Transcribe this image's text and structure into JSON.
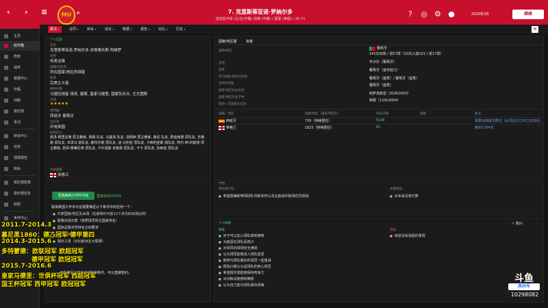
{
  "top": {
    "club_crest_text": "MU",
    "player_title": "7. 克里斯蒂亚诺·罗纳尔多",
    "player_sub": "进攻型中场 (右/左/中路) 前锋 (中路) / 曼联 (英超) / 26 (?)",
    "date": "2026年3月",
    "continue_label": "继续"
  },
  "sidebar": {
    "items": [
      {
        "label": "主页"
      },
      {
        "label": "收件箱"
      },
      {
        "label": "阵容"
      },
      {
        "label": "战术"
      },
      {
        "label": "数据中心"
      },
      {
        "label": "日程"
      },
      {
        "label": "训练"
      },
      {
        "label": "俱乐部"
      },
      {
        "label": "青训"
      },
      {
        "label": "转会中心"
      },
      {
        "label": "任务"
      },
      {
        "label": "球探报告"
      },
      {
        "label": "转会"
      },
      {
        "label": "俱乐部愿景"
      },
      {
        "label": "俱乐部信息"
      },
      {
        "label": "财政"
      },
      {
        "label": "世界中心"
      }
    ]
  },
  "tabs": [
    {
      "label": "概况"
    },
    {
      "label": "合同"
    },
    {
      "label": "转会"
    },
    {
      "label": "成长"
    },
    {
      "label": "数据"
    },
    {
      "label": "报告"
    },
    {
      "label": "对比"
    },
    {
      "label": "历史"
    }
  ],
  "left": {
    "header": "个人信息",
    "full_name_label": "全名",
    "full_name": "克里斯蒂亚诺·罗纳尔多·多斯桑托斯·阿维罗",
    "nickname_label": "昵称",
    "nickname": "传奇边锋",
    "origin_label": "国籍/出生地",
    "origin": "所在国家/地区的球星",
    "personality_label": "性格",
    "personality": "完美主义者",
    "media_label": "媒体形象",
    "media": "马德拉球星 球员, 曼联, 皇家马德里, 国家队队长, 尤文图斯",
    "rep_label": "声望",
    "stars": "★★★★★",
    "foot_label": "惯用脚",
    "foot": "西班牙·葡萄牙",
    "hometown_label": "出生地",
    "hometown": "闪电英国",
    "relations_label": "欣赏的人",
    "relations": "若泽·穆里尼奥 原主教练, 佩佩 队友, 马塞洛 队友, 范佩西 原主教练, 鲁尼 队友, 费迪南德 原队友, 吉格斯 原队友, 本泽马 前队友, 斯科尔斯 原队友, 迪·马利亚 原队友, 卡西利亚斯 前队友, 阿尔·西·科斯塔 原主教练, 若昂·穆蒂尼奥 原队友, 卡尔洛斯·克鲁斯 原队友, 卡卡 原队友, 加西亚 原队友",
    "flag_label": "代表国家",
    "flag_country": "英格兰"
  },
  "contract": {
    "loan_button": "至纳纳纳工作许可证",
    "expiry": "直到30/6/2029",
    "intro": "取得英国工作许可证需要满足以下条件中的任何一个：",
    "conditions": [
      "代表国家/地区队出场（在获得许可前12个月内的出场比例）",
      "联赛出场次数（按照球员所在国家排名）",
      "国际足联世界排名达到要求",
      "俱乐部转会费",
      "相对工资（对比欧洲五大联赛）"
    ],
    "note": "目前满足工作许可证取得条件，可以直接签约。"
  },
  "nations": {
    "tab_a": "国籍/地区服",
    "tab_b": "资格",
    "subhead": "国籍/地区",
    "national_team_label": "出生地",
    "national_team_val": "葡萄牙",
    "caps_label": "出场",
    "caps_val": "141次出场 / 进57球（10次入选U21 / 进17球）",
    "first_label": "首秀",
    "first_val": "丰沙尔（葡萄牙）",
    "birthplace_label": "效力国家/地区的资格",
    "birthplace_val": "葡萄牙（宣布效力）",
    "wc_label": "世界杯次数",
    "wc_val": "葡萄牙（首秀）/ 葡萄牙（首秀）",
    "euro_label": "国家/地区队总出场",
    "euro_val": "葡萄牙（首秀）",
    "debut_label": "国家/地区队处子秀",
    "debut_val": "哈萨克斯坦（20/8/2003）",
    "last_label": "最后一次国家队出场",
    "last_val": "希腊（12/6/2004）",
    "table_headers": [
      "国籍 / 地区",
      "国籍/地区（国家/地区队）",
      "归化日期",
      "国籍",
      "备注"
    ],
    "rows": [
      {
        "country": "西班牙",
        "status": "730（持续居住）",
        "days": "5144",
        "note": "需要在西班牙居住（必须在122天之内归化）"
      },
      {
        "country": "英格兰",
        "status": "1825（持续居住）",
        "days": "61",
        "note": "剩余1764天"
      }
    ]
  },
  "plans": {
    "header": "计划",
    "col_a": "俱乐部计划",
    "col_b": "长期规划",
    "item_a": "希望莫蒂斯带领球队夺取奖杯以及在欧战中取得优异成绩",
    "item_b": "对未来没有打算"
  },
  "personal": {
    "header": "个人情绪",
    "happy_label": "高兴",
    "positives_header": "积极",
    "positives": [
      "对于可以加入球队感到满意",
      "为能留在球队而高兴",
      "对球员的球场安全满意",
      "认为球员能够进入球队首发",
      "期待与球队最好的球员一起奋战",
      "很高兴被认为是球队的核心球员",
      "希望俱乐部能够保持竞争力",
      "对训练设施感到满意",
      "认为自己能为球队做出贡献"
    ],
    "negatives_header": "消极",
    "negatives": [
      "目前没有消极的事情"
    ]
  },
  "overlay": {
    "lines": [
      "2011.7-2014.3",
      "慕尼黑1860：德乙冠军 德甲第四",
      "2014.3-2015.6",
      "多特蒙德：欧联冠军 欧超冠军",
      "德甲冠军 欧冠冠军",
      "2015.7-2016.6",
      "皇家马德里：世俱杯冠军 西超冠军",
      "国王杯冠军  西甲冠军  欧冠冠军"
    ],
    "douyu_logo": "斗鱼",
    "douyu_room_label": "房间号",
    "douyu_id": "10298082"
  },
  "colors": {
    "accent": "#c8102e",
    "green": "#4bd36a",
    "overlay_text": "#f5e300"
  }
}
